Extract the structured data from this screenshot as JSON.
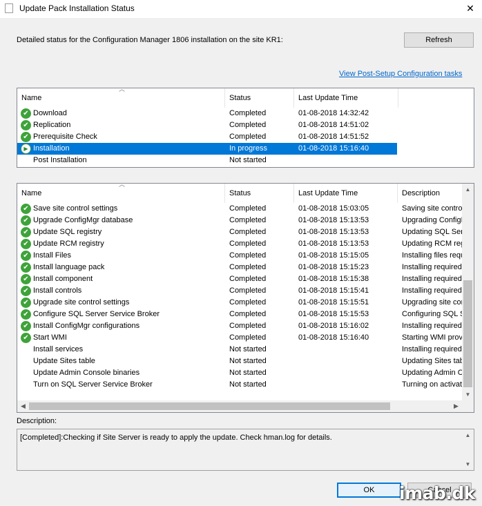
{
  "window": {
    "title": "Update Pack Installation Status",
    "close_glyph": "✕"
  },
  "intro_text": "Detailed status for the Configuration Manager 1806 installation on the site KR1:",
  "refresh_label": "Refresh",
  "post_setup_link": "View Post-Setup Configuration tasks",
  "top_list": {
    "columns": [
      "Name",
      "Status",
      "Last Update Time"
    ],
    "rows": [
      {
        "name": "Download",
        "status": "Completed",
        "time": "01-08-2018 14:32:42",
        "icon": "check-icon"
      },
      {
        "name": "Replication",
        "status": "Completed",
        "time": "01-08-2018 14:51:02",
        "icon": "check-icon"
      },
      {
        "name": "Prerequisite Check",
        "status": "Completed",
        "time": "01-08-2018 14:51:52",
        "icon": "check-icon"
      },
      {
        "name": "Installation",
        "status": "In progress",
        "time": "01-08-2018 15:16:40",
        "icon": "in-progress-icon",
        "selected": true
      },
      {
        "name": "Post Installation",
        "status": "Not started",
        "time": "",
        "icon": ""
      }
    ]
  },
  "bottom_list": {
    "columns": [
      "Name",
      "Status",
      "Last Update Time",
      "Description"
    ],
    "rows": [
      {
        "name": "Save site control settings",
        "status": "Completed",
        "time": "01-08-2018 15:03:05",
        "desc": "Saving site control",
        "icon": "check-icon"
      },
      {
        "name": "Upgrade ConfigMgr database",
        "status": "Completed",
        "time": "01-08-2018 15:13:53",
        "desc": "Upgrading ConfigM",
        "icon": "check-icon"
      },
      {
        "name": "Update SQL registry",
        "status": "Completed",
        "time": "01-08-2018 15:13:53",
        "desc": "Updating SQL Ser",
        "icon": "check-icon"
      },
      {
        "name": "Update RCM registry",
        "status": "Completed",
        "time": "01-08-2018 15:13:53",
        "desc": "Updating RCM reg",
        "icon": "check-icon"
      },
      {
        "name": "Install Files",
        "status": "Completed",
        "time": "01-08-2018 15:15:05",
        "desc": "Installing files requi",
        "icon": "check-icon"
      },
      {
        "name": "Install language pack",
        "status": "Completed",
        "time": "01-08-2018 15:15:23",
        "desc": "Installing required l",
        "icon": "check-icon"
      },
      {
        "name": "Install component",
        "status": "Completed",
        "time": "01-08-2018 15:15:38",
        "desc": "Installing required c",
        "icon": "check-icon"
      },
      {
        "name": "Install controls",
        "status": "Completed",
        "time": "01-08-2018 15:15:41",
        "desc": "Installing required c",
        "icon": "check-icon"
      },
      {
        "name": "Upgrade site control settings",
        "status": "Completed",
        "time": "01-08-2018 15:15:51",
        "desc": "Upgrading site con",
        "icon": "check-icon"
      },
      {
        "name": "Configure SQL Server Service Broker",
        "status": "Completed",
        "time": "01-08-2018 15:15:53",
        "desc": "Configuring SQL S",
        "icon": "check-icon"
      },
      {
        "name": "Install ConfigMgr configurations",
        "status": "Completed",
        "time": "01-08-2018 15:16:02",
        "desc": "Installing required C",
        "icon": "check-icon"
      },
      {
        "name": "Start WMI",
        "status": "Completed",
        "time": "01-08-2018 15:16:40",
        "desc": "Starting WMI provi",
        "icon": "check-icon"
      },
      {
        "name": "Install services",
        "status": "Not started",
        "time": "",
        "desc": "Installing required s",
        "icon": ""
      },
      {
        "name": "Update Sites table",
        "status": "Not started",
        "time": "",
        "desc": "Updating Sites tab",
        "icon": ""
      },
      {
        "name": "Update Admin Console binaries",
        "status": "Not started",
        "time": "",
        "desc": "Updating Admin Co",
        "icon": ""
      },
      {
        "name": "Turn on SQL Server Service Broker",
        "status": "Not started",
        "time": "",
        "desc": "Turning on activati",
        "icon": ""
      }
    ]
  },
  "description": {
    "label": "Description:",
    "text": "[Completed]:Checking if Site Server is ready to apply the update. Check hman.log for details."
  },
  "ok_label": "OK",
  "cancel_label": "Cancel",
  "watermark": "imab.dk",
  "colors": {
    "selected": "#0078d7",
    "check": "#3ea33a",
    "link": "#0066cc"
  }
}
